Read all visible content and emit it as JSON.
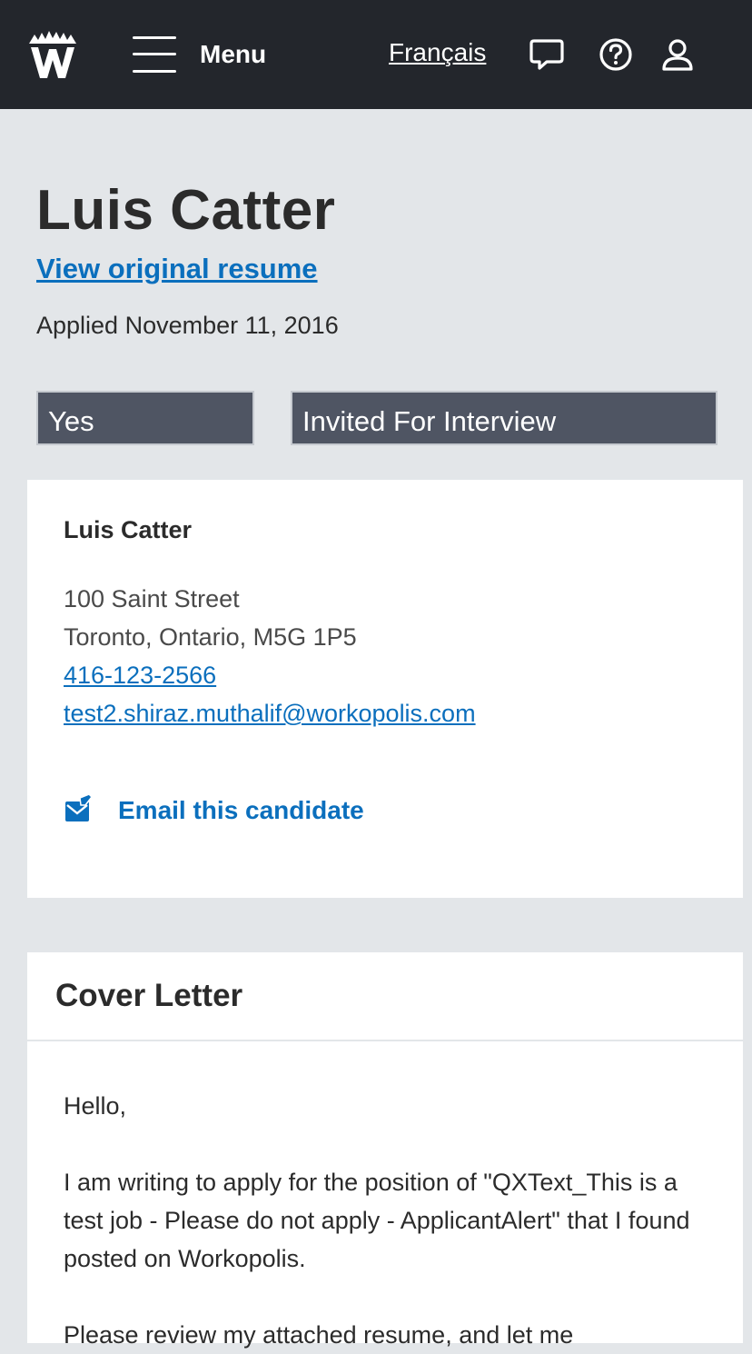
{
  "header": {
    "logo": "workopolis-logo",
    "menu_label": "Menu",
    "language_link": "Français",
    "icons": [
      "chat-icon",
      "help-icon",
      "user-icon"
    ]
  },
  "candidate": {
    "name": "Luis Catter",
    "view_resume_link": "View original resume",
    "applied": "Applied November 11, 2016"
  },
  "status": {
    "shortlist": "Yes",
    "stage": "Invited For Interview"
  },
  "contact": {
    "name": "Luis Catter",
    "street": "100 Saint Street",
    "city": "Toronto, Ontario, M5G 1P5",
    "phone": "416-123-2566",
    "email": "test2.shiraz.muthalif@workopolis.com",
    "email_action": "Email this candidate"
  },
  "cover_letter": {
    "title": "Cover Letter",
    "paragraphs": [
      "Hello,",
      "I am writing to apply for the position of \"QXText_This is a test job - Please do not apply - ApplicantAlert\" that I found posted on Workopolis.",
      "Please review my attached resume, and let me"
    ]
  },
  "colors": {
    "header_bg": "#23262c",
    "page_bg": "#e3e6e9",
    "link": "#0b6fbd",
    "status_bg": "#4f5563"
  }
}
